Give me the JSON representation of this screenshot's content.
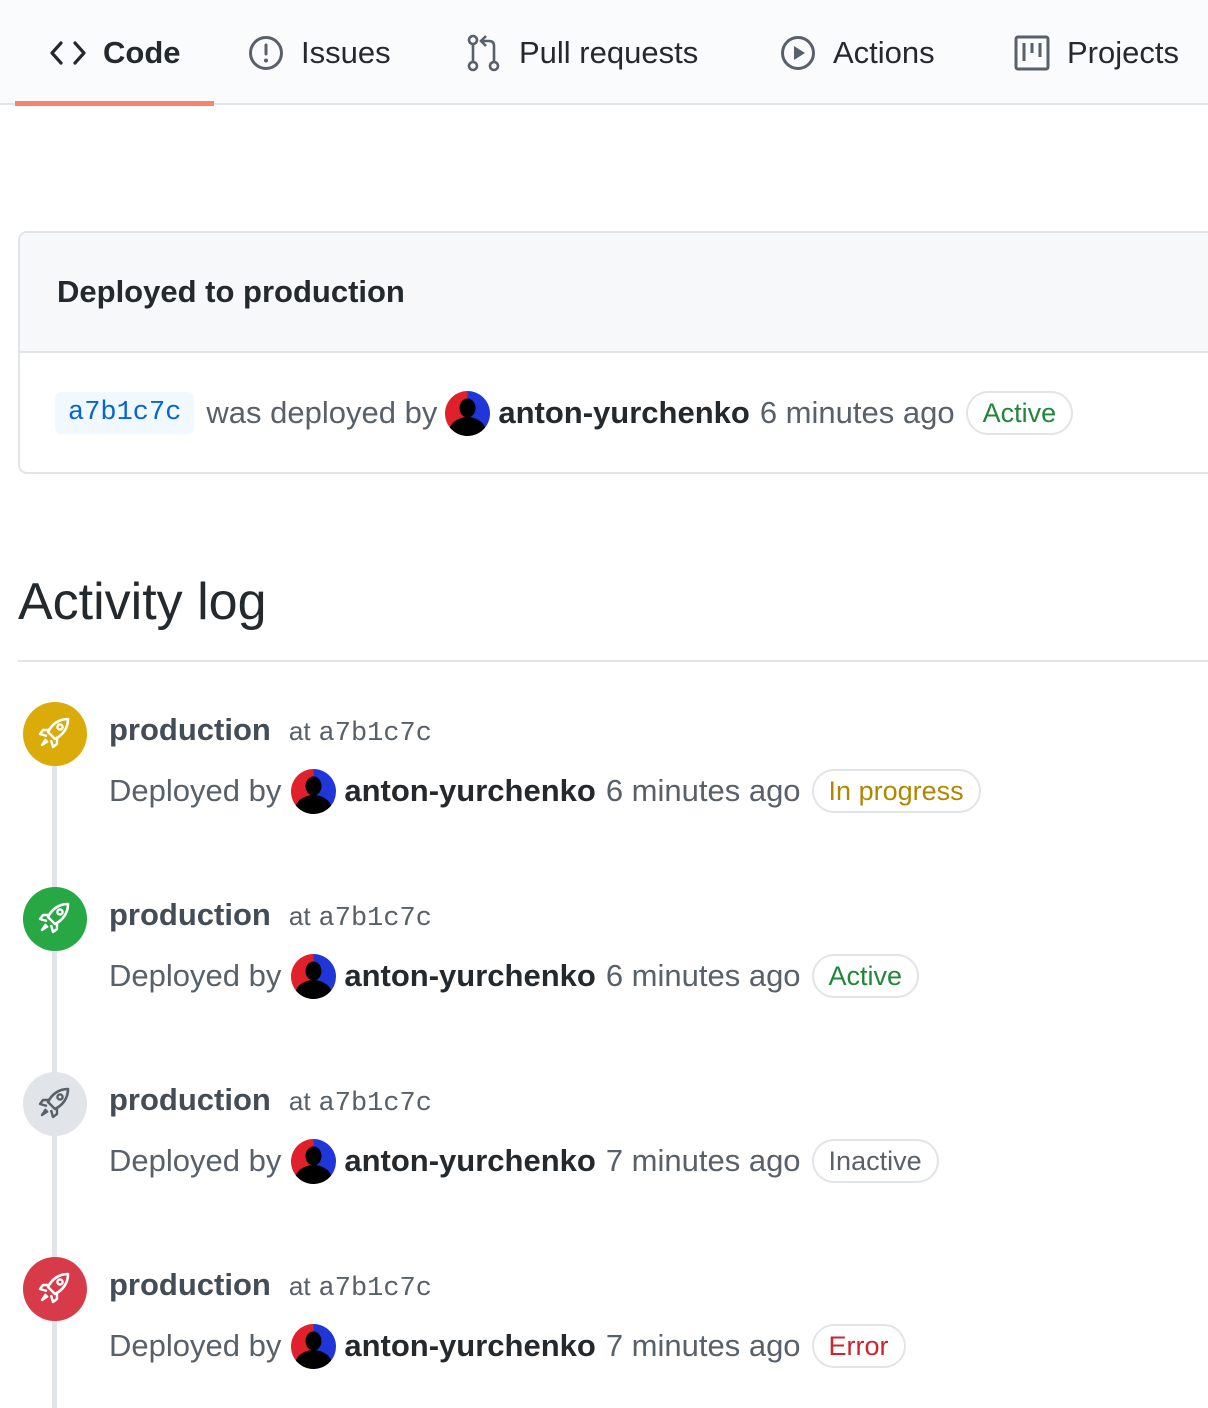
{
  "nav": {
    "tabs": [
      {
        "label": "Code",
        "icon": "code-icon",
        "selected": true
      },
      {
        "label": "Issues",
        "icon": "issue-opened-icon",
        "selected": false
      },
      {
        "label": "Pull requests",
        "icon": "git-pull-request-icon",
        "selected": false
      },
      {
        "label": "Actions",
        "icon": "play-icon",
        "selected": false
      },
      {
        "label": "Projects",
        "icon": "project-icon",
        "selected": false
      }
    ]
  },
  "deployment": {
    "title": "Deployed to production",
    "sha": "a7b1c7c",
    "deployed_text": "was deployed by",
    "author": "anton-yurchenko",
    "time": "6 minutes ago",
    "status": "Active"
  },
  "activity": {
    "title": "Activity log",
    "events": [
      {
        "environment": "production",
        "at_label": "at",
        "sha": "a7b1c7c",
        "deployed_by_label": "Deployed by",
        "author": "anton-yurchenko",
        "time": "6 minutes ago",
        "status": "In progress",
        "badge_color": "#dbab09",
        "icon": "rocket-icon"
      },
      {
        "environment": "production",
        "at_label": "at",
        "sha": "a7b1c7c",
        "deployed_by_label": "Deployed by",
        "author": "anton-yurchenko",
        "time": "6 minutes ago",
        "status": "Active",
        "badge_color": "#28a745",
        "icon": "rocket-icon"
      },
      {
        "environment": "production",
        "at_label": "at",
        "sha": "a7b1c7c",
        "deployed_by_label": "Deployed by",
        "author": "anton-yurchenko",
        "time": "7 minutes ago",
        "status": "Inactive",
        "badge_color": "#e1e4e8",
        "icon": "rocket-icon"
      },
      {
        "environment": "production",
        "at_label": "at",
        "sha": "a7b1c7c",
        "deployed_by_label": "Deployed by",
        "author": "anton-yurchenko",
        "time": "7 minutes ago",
        "status": "Error",
        "badge_color": "#d73a49",
        "icon": "rocket-icon"
      }
    ]
  },
  "colors": {
    "accent_underline": "#f9826c",
    "link_blue": "#0366d6",
    "success_green": "#22863a",
    "warning_yellow": "#b08800",
    "error_red": "#cb2431"
  }
}
